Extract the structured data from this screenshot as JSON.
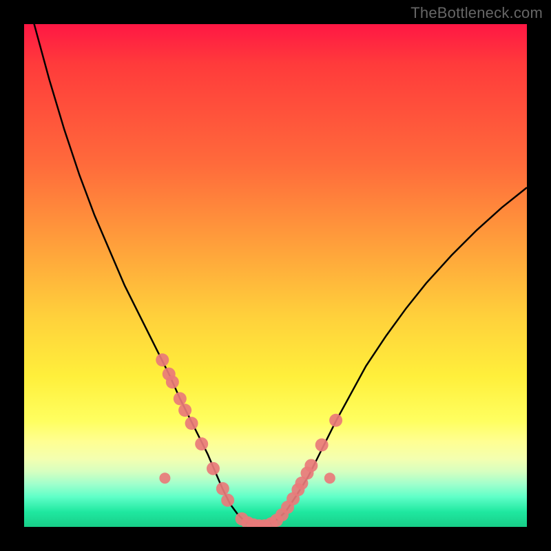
{
  "watermark": "TheBottleneck.com",
  "chart_data": {
    "type": "line",
    "title": "",
    "xlabel": "",
    "ylabel": "",
    "xlim": [
      0,
      100
    ],
    "ylim": [
      0,
      100
    ],
    "series": [
      {
        "name": "bottleneck-curve",
        "x": [
          0,
          2,
          5,
          8,
          11,
          14,
          17,
          20,
          23,
          26,
          29,
          31,
          33,
          35,
          36.5,
          38,
          39.5,
          41,
          42.5,
          44,
          46,
          48,
          50,
          52,
          54,
          56.5,
          59,
          62,
          65,
          68,
          72,
          76,
          80,
          85,
          90,
          95,
          100
        ],
        "y": [
          108,
          100,
          89,
          79,
          70,
          62,
          55,
          48,
          42,
          36,
          30,
          25.5,
          21.5,
          17.5,
          14.5,
          11,
          7.5,
          4.5,
          2.5,
          1,
          0.2,
          0.2,
          1.2,
          3,
          6,
          10,
          15,
          21,
          26.5,
          32,
          38,
          43.5,
          48.5,
          54,
          59,
          63.5,
          67.5
        ]
      }
    ],
    "markers": [
      {
        "x": 27.5,
        "y": 33.2
      },
      {
        "x": 28.8,
        "y": 30.4
      },
      {
        "x": 29.5,
        "y": 28.8
      },
      {
        "x": 31.0,
        "y": 25.5
      },
      {
        "x": 32.0,
        "y": 23.2
      },
      {
        "x": 33.3,
        "y": 20.6
      },
      {
        "x": 35.3,
        "y": 16.5
      },
      {
        "x": 37.6,
        "y": 11.6
      },
      {
        "x": 39.5,
        "y": 7.6
      },
      {
        "x": 40.5,
        "y": 5.3
      },
      {
        "x": 43.3,
        "y": 1.6
      },
      {
        "x": 44.5,
        "y": 0.8
      },
      {
        "x": 45.6,
        "y": 0.4
      },
      {
        "x": 46.7,
        "y": 0.2
      },
      {
        "x": 47.8,
        "y": 0.2
      },
      {
        "x": 49.1,
        "y": 0.6
      },
      {
        "x": 50.2,
        "y": 1.3
      },
      {
        "x": 51.3,
        "y": 2.4
      },
      {
        "x": 52.4,
        "y": 3.9
      },
      {
        "x": 53.5,
        "y": 5.6
      },
      {
        "x": 54.5,
        "y": 7.4
      },
      {
        "x": 55.2,
        "y": 8.7
      },
      {
        "x": 56.3,
        "y": 10.7
      },
      {
        "x": 57.1,
        "y": 12.2
      },
      {
        "x": 59.2,
        "y": 16.3
      },
      {
        "x": 62.0,
        "y": 21.2
      },
      {
        "x": 28.0,
        "y": 9.7,
        "isolated": true
      },
      {
        "x": 60.8,
        "y": 9.7,
        "isolated": true
      }
    ]
  }
}
